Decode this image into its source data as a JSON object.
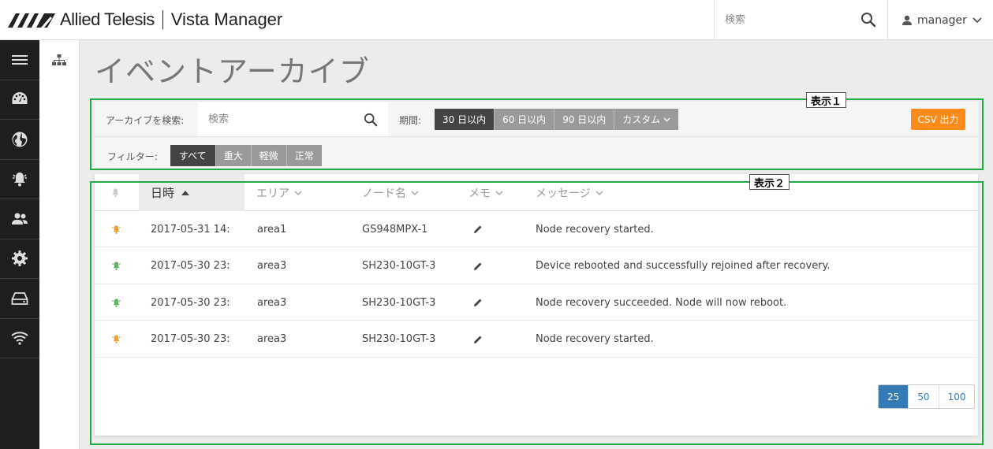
{
  "header": {
    "brand": "Allied Telesis",
    "product": "Vista Manager",
    "search_placeholder": "検索",
    "user_name": "manager"
  },
  "sidebar": {
    "items": [
      "menu-icon",
      "dashboard-icon",
      "globe-icon",
      "alarm-icon",
      "users-icon",
      "gear-icon",
      "storage-icon",
      "wifi-icon"
    ]
  },
  "page": {
    "title": "イベントアーカイブ"
  },
  "filters": {
    "archive_search_label": "アーカイブを検索:",
    "archive_search_placeholder": "検索",
    "period_label": "期間:",
    "period_options": [
      "30 日以内",
      "60 日以内",
      "90 日以内",
      "カスタム"
    ],
    "period_selected": "30 日以内",
    "csv_label": "CSV 出力",
    "filter_label": "フィルター:",
    "severity_options": [
      "すべて",
      "重大",
      "軽微",
      "正常"
    ],
    "severity_selected": "すべて"
  },
  "table": {
    "columns": [
      "日時",
      "エリア",
      "ノード名",
      "メモ",
      "メッセージ"
    ],
    "sorted_column": "日時",
    "rows": [
      {
        "severity": "minor",
        "datetime": "2017-05-31 14:",
        "area": "area1",
        "node": "GS948MPX-1",
        "message": "Node recovery started."
      },
      {
        "severity": "normal",
        "datetime": "2017-05-30 23:",
        "area": "area3",
        "node": "SH230-10GT-3",
        "message": "Device rebooted and successfully rejoined after recovery."
      },
      {
        "severity": "normal",
        "datetime": "2017-05-30 23:",
        "area": "area3",
        "node": "SH230-10GT-3",
        "message": "Node recovery succeeded. Node will now reboot."
      },
      {
        "severity": "minor",
        "datetime": "2017-05-30 23:",
        "area": "area3",
        "node": "SH230-10GT-3",
        "message": "Node recovery started."
      }
    ],
    "page_sizes": [
      "25",
      "50",
      "100"
    ],
    "page_size_selected": "25"
  },
  "colors": {
    "minor": "#f0a030",
    "normal": "#5cb85c",
    "accent": "#337ab7",
    "csv": "#ff8c1a",
    "annotation": "#22aa44"
  },
  "annotations": {
    "label1": "表示１",
    "label2": "表示２"
  }
}
